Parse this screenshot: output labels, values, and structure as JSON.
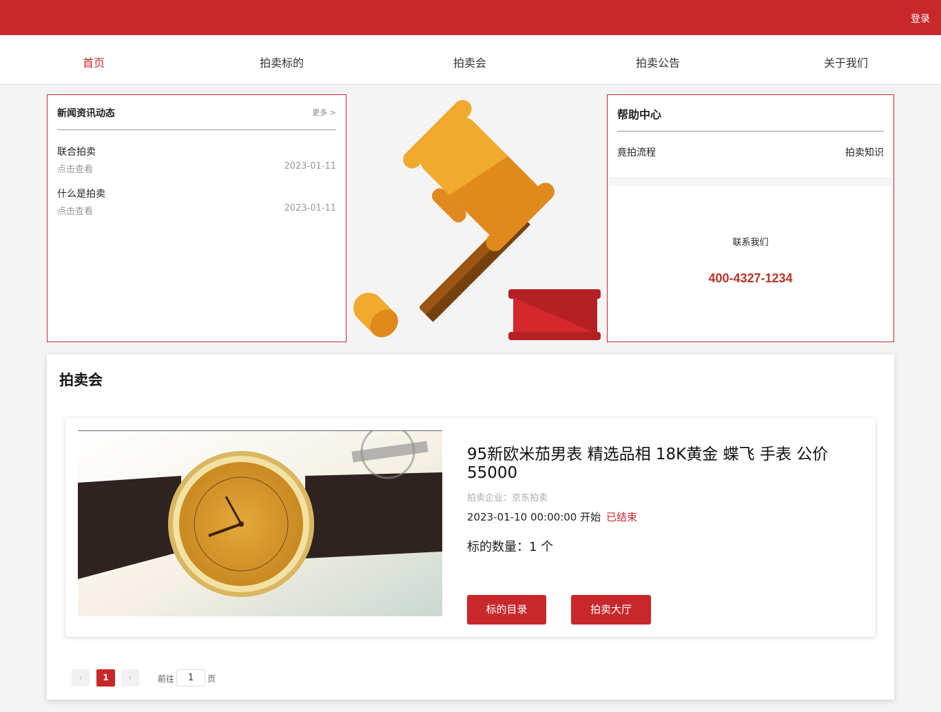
{
  "header": {
    "login_label": "登录"
  },
  "nav": {
    "items": [
      {
        "label": "首页"
      },
      {
        "label": "拍卖标的"
      },
      {
        "label": "拍卖会"
      },
      {
        "label": "拍卖公告"
      },
      {
        "label": "关于我们"
      }
    ],
    "active_index": 0
  },
  "news": {
    "title": "新闻资讯动态",
    "more_label": "更多 >",
    "items": [
      {
        "title": "联合拍卖",
        "link_text": "点击查看",
        "date": "2023-01-11"
      },
      {
        "title": "什么是拍卖",
        "link_text": "点击查看",
        "date": "2023-01-11"
      }
    ]
  },
  "banner": {
    "icon": "gavel-illustration"
  },
  "help": {
    "title": "帮助中心",
    "links": [
      {
        "label": "竟拍流程"
      },
      {
        "label": "拍卖知识"
      }
    ],
    "contact_label": "联系我们",
    "phone": "400-4327-1234"
  },
  "auction": {
    "section_title": "拍卖会",
    "items": [
      {
        "name": "95新欧米茄男表 精选品相 18K黄金 蝶飞 手表 公价55000",
        "company": "拍卖企业：京东拍卖",
        "start_time": "2023-01-10 00:00:00 开始",
        "status": "已结束",
        "count": "标的数量：1 个",
        "btn_catalog": "标的目录",
        "btn_hall": "拍卖大厅",
        "image": "gold-watch-photo"
      }
    ]
  },
  "pagination": {
    "prev_icon": "‹",
    "current": "1",
    "next_icon": "›",
    "goto_label": "前往",
    "input_value": "1",
    "page_label": "页"
  },
  "colors": {
    "brand": "#c8282c",
    "phone": "#b8342a",
    "status": "#c8282c"
  }
}
